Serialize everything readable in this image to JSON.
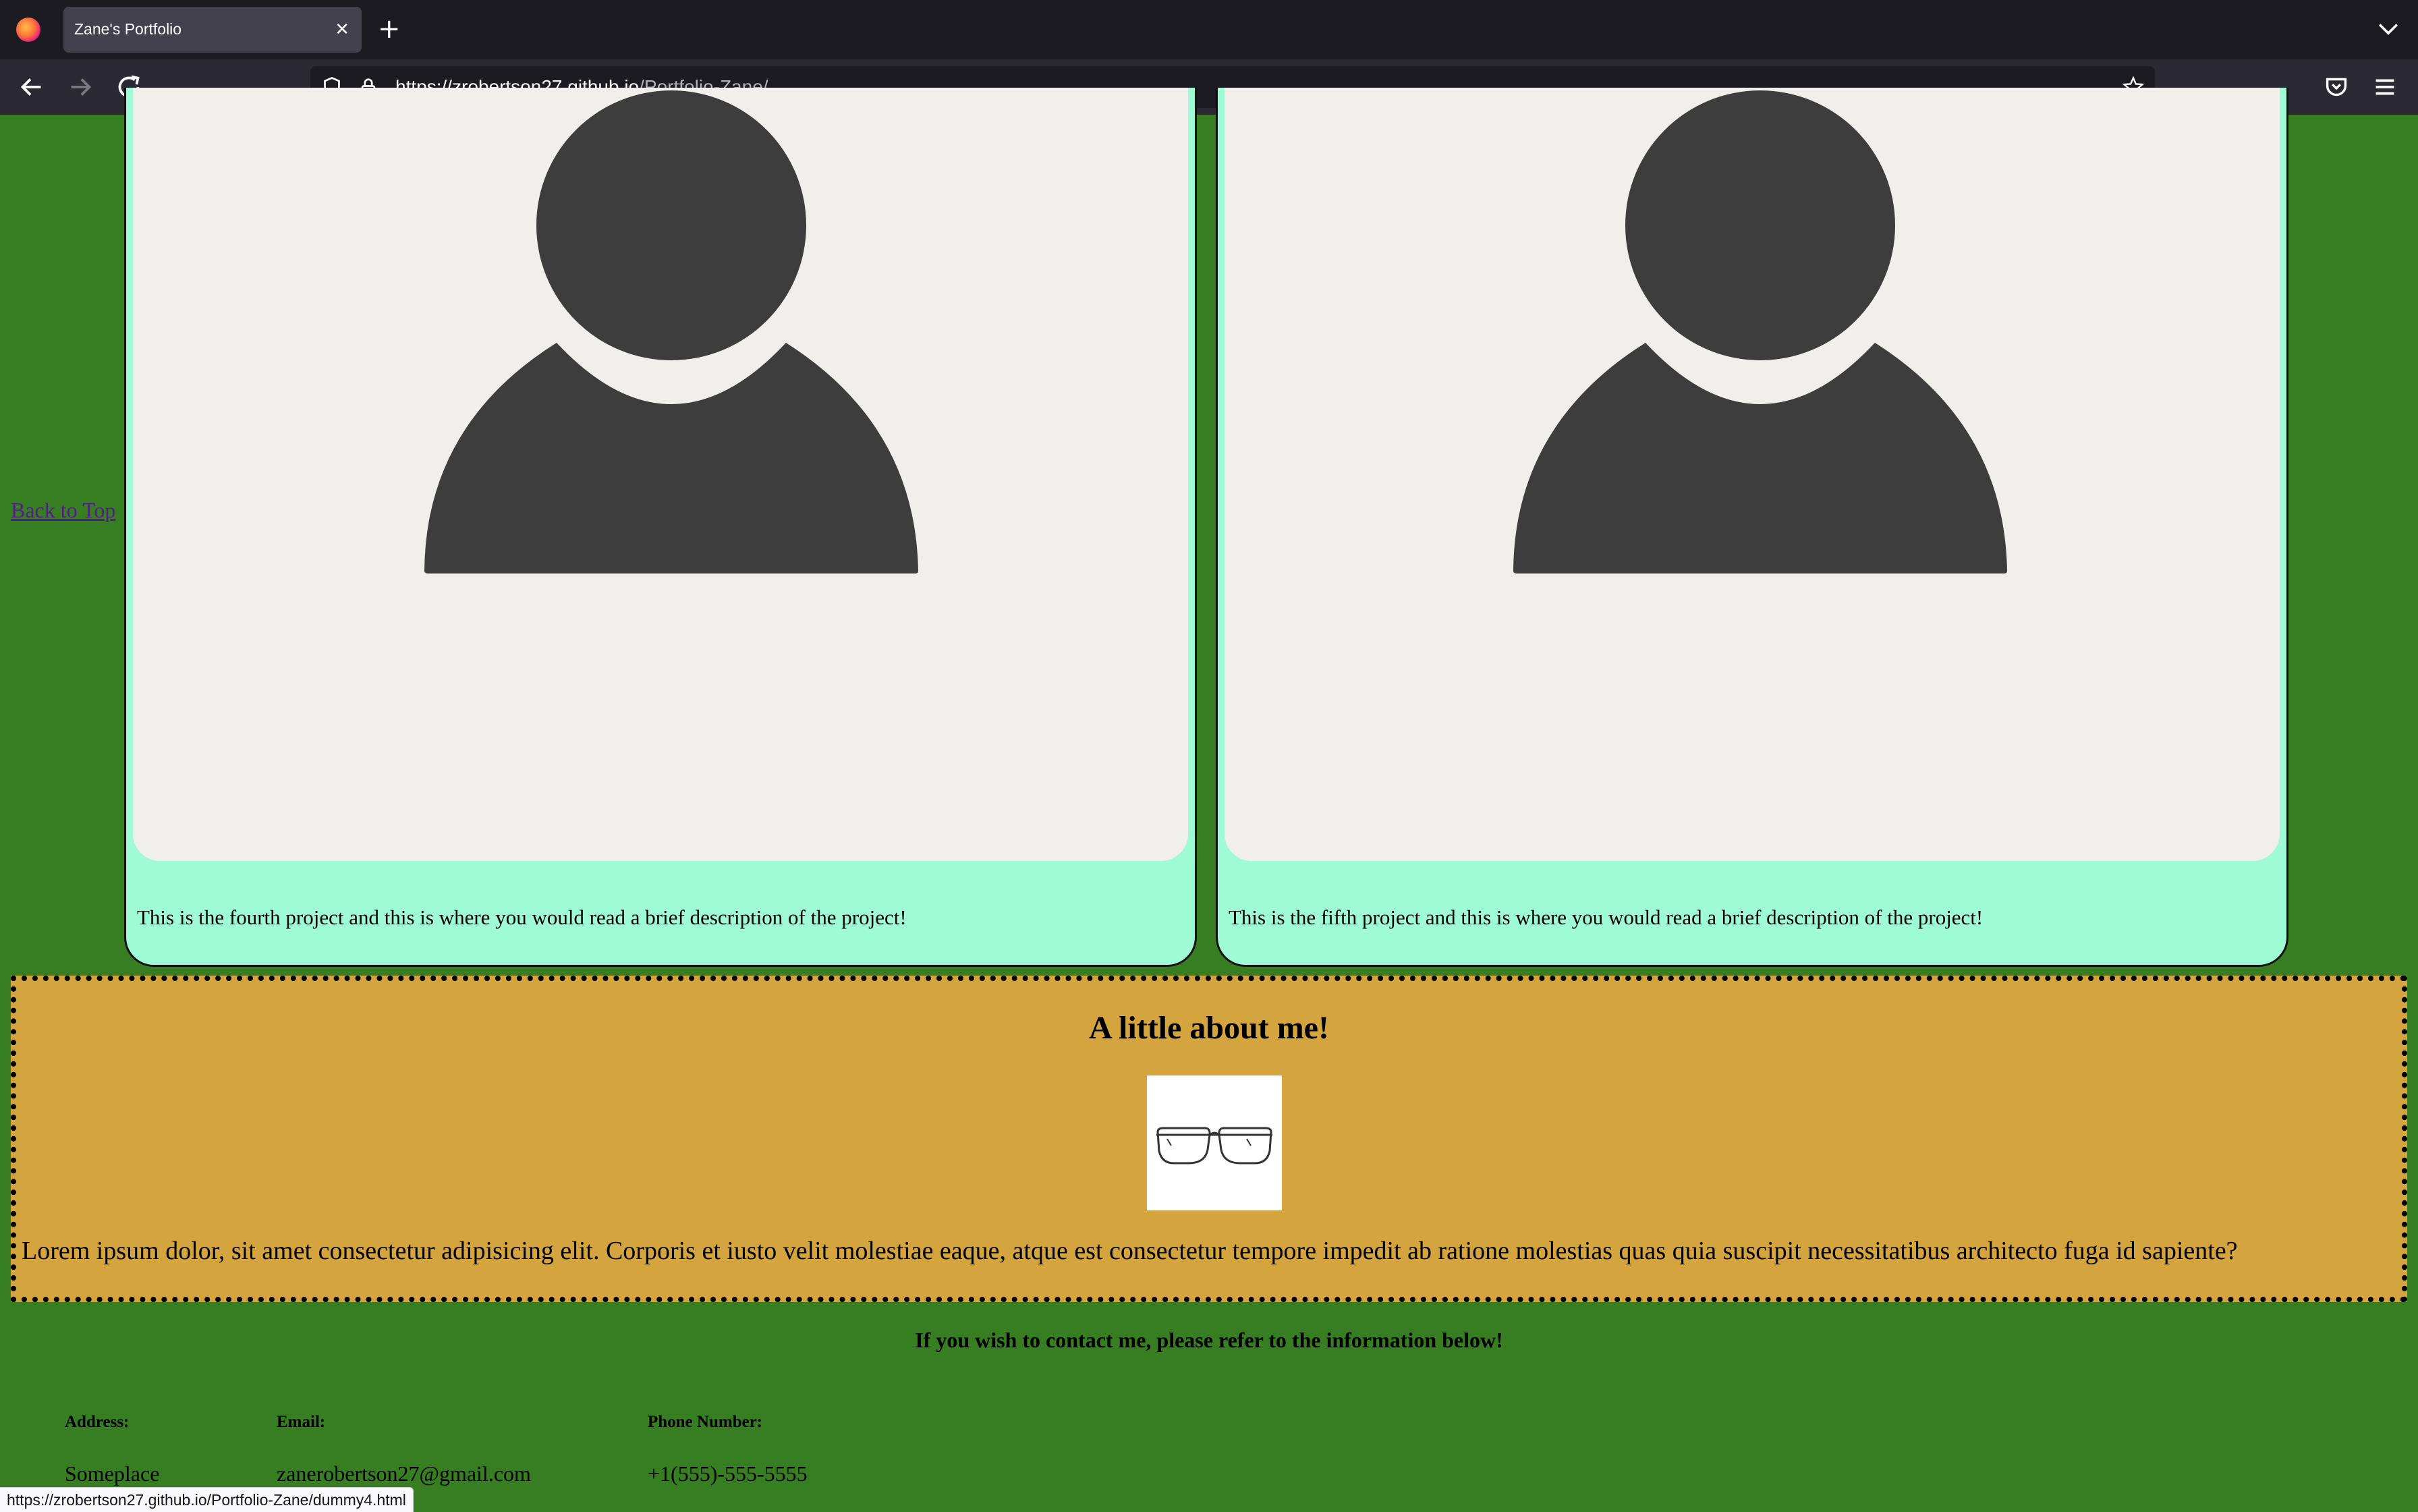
{
  "browser": {
    "tab_title": "Zane's Portfolio",
    "url_host": "https://zrobertson27.github.io",
    "url_path": "/Portfolio-Zane/",
    "status_url": "https://zrobertson27.github.io/Portfolio-Zane/dummy4.html"
  },
  "page": {
    "back_to_top": "Back to Top",
    "projects": [
      {
        "description": "This is the fourth project and this is where you would read a brief description of the project!"
      },
      {
        "description": "This is the fifth project and this is where you would read a brief description of the project!"
      }
    ],
    "about": {
      "title": "A little about me!",
      "text": "Lorem ipsum dolor, sit amet consectetur adipisicing elit. Corporis et iusto velit molestiae eaque, atque est consectetur tempore impedit ab ratione molestias quas quia suscipit necessitatibus architecto fuga id sapiente?"
    },
    "contact": {
      "heading": "If you wish to contact me, please refer to the information below!",
      "address_label": "Address:",
      "address_value": "Someplace",
      "email_label": "Email:",
      "email_value": "zanerobertson27@gmail.com",
      "phone_label": "Phone Number:",
      "phone_value": "+1(555)-555-5555"
    }
  },
  "colors": {
    "page_bg": "#377e22",
    "card_bg": "#9ffad6",
    "about_bg": "#d4a53f"
  }
}
